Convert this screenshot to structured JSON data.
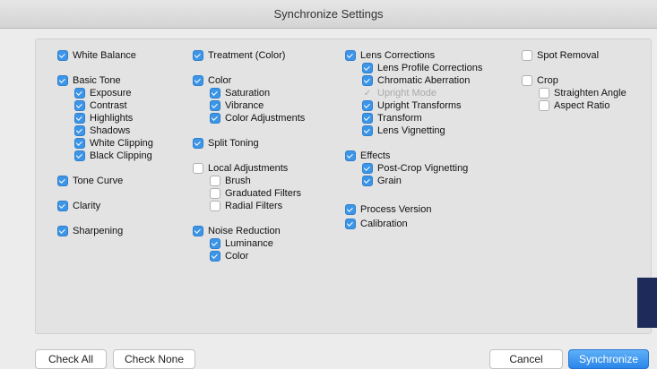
{
  "window": {
    "title": "Synchronize Settings"
  },
  "columns": [
    [
      {
        "label": "White Balance",
        "state": "on"
      },
      {
        "label": "Basic Tone",
        "state": "on"
      },
      {
        "label": "Exposure",
        "state": "on"
      },
      {
        "label": "Contrast",
        "state": "on"
      },
      {
        "label": "Highlights",
        "state": "on"
      },
      {
        "label": "Shadows",
        "state": "on"
      },
      {
        "label": "White Clipping",
        "state": "on"
      },
      {
        "label": "Black Clipping",
        "state": "on"
      },
      {
        "label": "Tone Curve",
        "state": "on"
      },
      {
        "label": "Clarity",
        "state": "on"
      },
      {
        "label": "Sharpening",
        "state": "on"
      }
    ],
    [
      {
        "label": "Treatment (Color)",
        "state": "on"
      },
      {
        "label": "Color",
        "state": "on"
      },
      {
        "label": "Saturation",
        "state": "on"
      },
      {
        "label": "Vibrance",
        "state": "on"
      },
      {
        "label": "Color Adjustments",
        "state": "on"
      },
      {
        "label": "Split Toning",
        "state": "on"
      },
      {
        "label": "Local Adjustments",
        "state": "off"
      },
      {
        "label": "Brush",
        "state": "off"
      },
      {
        "label": "Graduated Filters",
        "state": "off"
      },
      {
        "label": "Radial Filters",
        "state": "off"
      },
      {
        "label": "Noise Reduction",
        "state": "on"
      },
      {
        "label": "Luminance",
        "state": "on"
      },
      {
        "label": "Color",
        "state": "on"
      }
    ],
    [
      {
        "label": "Lens Corrections",
        "state": "on"
      },
      {
        "label": "Lens Profile Corrections",
        "state": "on"
      },
      {
        "label": "Chromatic Aberration",
        "state": "on"
      },
      {
        "label": "Upright Mode",
        "state": "disabled"
      },
      {
        "label": "Upright Transforms",
        "state": "on"
      },
      {
        "label": "Transform",
        "state": "on"
      },
      {
        "label": "Lens Vignetting",
        "state": "on"
      },
      {
        "label": "Effects",
        "state": "on"
      },
      {
        "label": "Post-Crop Vignetting",
        "state": "on"
      },
      {
        "label": "Grain",
        "state": "on"
      },
      {
        "label": "Process Version",
        "state": "on"
      },
      {
        "label": "Calibration",
        "state": "on"
      }
    ],
    [
      {
        "label": "Spot Removal",
        "state": "off"
      },
      {
        "label": "Crop",
        "state": "off"
      },
      {
        "label": "Straighten Angle",
        "state": "off"
      },
      {
        "label": "Aspect Ratio",
        "state": "off"
      }
    ]
  ],
  "buttons": {
    "check_all": "Check All",
    "check_none": "Check None",
    "cancel": "Cancel",
    "synchronize": "Synchronize"
  },
  "colors": {
    "accent": "#3c95e6",
    "primary_button": "#2a86ea"
  }
}
